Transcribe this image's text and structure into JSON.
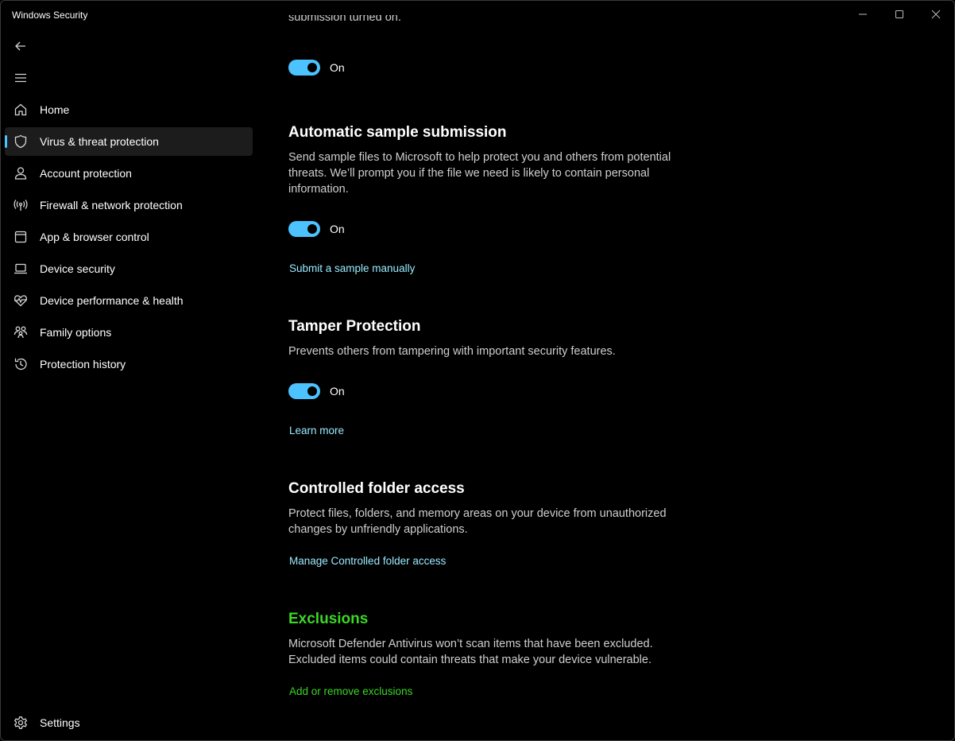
{
  "window": {
    "title": "Windows Security",
    "controls": [
      "minimize",
      "maximize",
      "close"
    ]
  },
  "sidebar": {
    "back_icon": "back-arrow-icon",
    "menu_icon": "hamburger-menu-icon",
    "items": [
      {
        "label": "Home",
        "icon": "home-icon",
        "selected": false
      },
      {
        "label": "Virus & threat protection",
        "icon": "shield-icon",
        "selected": true
      },
      {
        "label": "Account protection",
        "icon": "person-icon",
        "selected": false
      },
      {
        "label": "Firewall & network protection",
        "icon": "wifi-antenna-icon",
        "selected": false
      },
      {
        "label": "App & browser control",
        "icon": "app-window-icon",
        "selected": false
      },
      {
        "label": "Device security",
        "icon": "laptop-icon",
        "selected": false
      },
      {
        "label": "Device performance & health",
        "icon": "heart-pulse-icon",
        "selected": false
      },
      {
        "label": "Family options",
        "icon": "family-icon",
        "selected": false
      },
      {
        "label": "Protection history",
        "icon": "history-icon",
        "selected": false
      }
    ],
    "settings": {
      "label": "Settings",
      "icon": "gear-icon"
    }
  },
  "content": {
    "clipped_text": "submission turned on.",
    "top_toggle": {
      "state_label": "On",
      "on": true
    },
    "sample_submission": {
      "title": "Automatic sample submission",
      "desc": "Send sample files to Microsoft to help protect you and others from potential threats. We’ll prompt you if the file we need is likely to contain personal information.",
      "toggle_label": "On",
      "link": "Submit a sample manually"
    },
    "tamper": {
      "title": "Tamper Protection",
      "desc": "Prevents others from tampering with important security features.",
      "toggle_label": "On",
      "link": "Learn more"
    },
    "controlled_folder": {
      "title": "Controlled folder access",
      "desc": "Protect files, folders, and memory areas on your device from unauthorized changes by unfriendly applications.",
      "link": "Manage Controlled folder access"
    },
    "exclusions": {
      "title": "Exclusions",
      "desc": "Microsoft Defender Antivirus won’t scan items that have been excluded. Excluded items could contain threats that make your device vulnerable.",
      "link": "Add or remove exclusions"
    }
  },
  "colors": {
    "accent": "#4cc2ff",
    "link": "#99ebff",
    "highlight_green": "#3cd626",
    "background": "#000000",
    "selected_nav": "#1c1c1c"
  }
}
